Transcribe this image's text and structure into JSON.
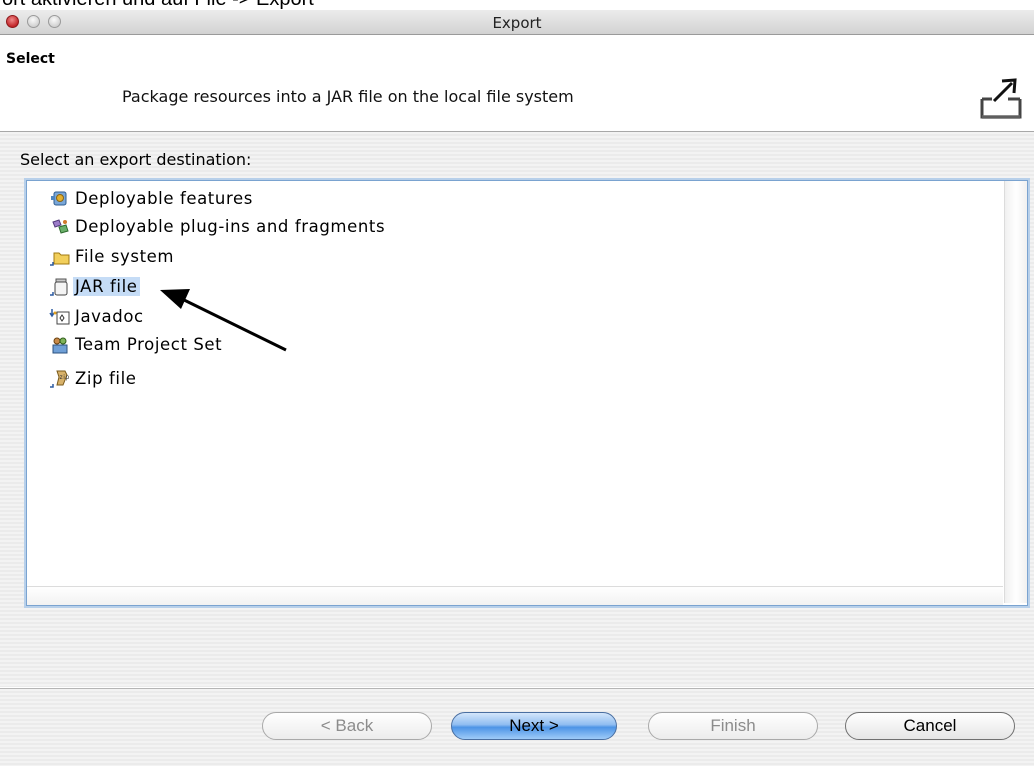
{
  "window": {
    "caption_fragment": "ort aktivieren und auf File -> Export",
    "title": "Export"
  },
  "banner": {
    "title": "Select",
    "description": "Package resources into a JAR file on the local file system",
    "icon": "export-icon"
  },
  "destination": {
    "label": "Select an export destination:",
    "items": [
      {
        "label": "Deployable features",
        "icon": "feature-icon",
        "selected": false
      },
      {
        "label": "Deployable plug-ins and fragments",
        "icon": "plugin-icon",
        "selected": false
      },
      {
        "label": "File system",
        "icon": "folder-icon",
        "selected": false
      },
      {
        "label": "JAR file",
        "icon": "jar-icon",
        "selected": true
      },
      {
        "label": "Javadoc",
        "icon": "javadoc-icon",
        "selected": false
      },
      {
        "label": "Team Project Set",
        "icon": "team-icon",
        "selected": false
      },
      {
        "label": "Zip file",
        "icon": "zip-icon",
        "selected": false
      }
    ]
  },
  "buttons": {
    "back": "< Back",
    "next": "Next >",
    "finish": "Finish",
    "cancel": "Cancel"
  },
  "colors": {
    "selection": "#c5dcf6",
    "default_button": "#4d94e6",
    "close_light": "#c2262a"
  }
}
